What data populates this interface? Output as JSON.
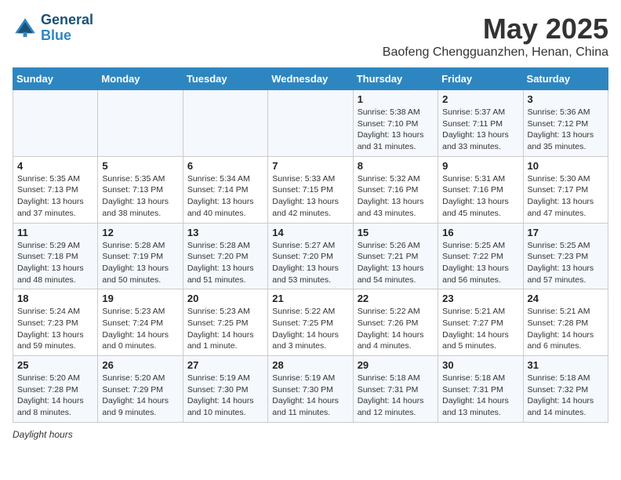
{
  "header": {
    "logo_line1": "General",
    "logo_line2": "Blue",
    "month": "May 2025",
    "location": "Baofeng Chengguanzhen, Henan, China"
  },
  "weekdays": [
    "Sunday",
    "Monday",
    "Tuesday",
    "Wednesday",
    "Thursday",
    "Friday",
    "Saturday"
  ],
  "weeks": [
    [
      {
        "day": "",
        "info": ""
      },
      {
        "day": "",
        "info": ""
      },
      {
        "day": "",
        "info": ""
      },
      {
        "day": "",
        "info": ""
      },
      {
        "day": "1",
        "info": "Sunrise: 5:38 AM\nSunset: 7:10 PM\nDaylight: 13 hours\nand 31 minutes."
      },
      {
        "day": "2",
        "info": "Sunrise: 5:37 AM\nSunset: 7:11 PM\nDaylight: 13 hours\nand 33 minutes."
      },
      {
        "day": "3",
        "info": "Sunrise: 5:36 AM\nSunset: 7:12 PM\nDaylight: 13 hours\nand 35 minutes."
      }
    ],
    [
      {
        "day": "4",
        "info": "Sunrise: 5:35 AM\nSunset: 7:13 PM\nDaylight: 13 hours\nand 37 minutes."
      },
      {
        "day": "5",
        "info": "Sunrise: 5:35 AM\nSunset: 7:13 PM\nDaylight: 13 hours\nand 38 minutes."
      },
      {
        "day": "6",
        "info": "Sunrise: 5:34 AM\nSunset: 7:14 PM\nDaylight: 13 hours\nand 40 minutes."
      },
      {
        "day": "7",
        "info": "Sunrise: 5:33 AM\nSunset: 7:15 PM\nDaylight: 13 hours\nand 42 minutes."
      },
      {
        "day": "8",
        "info": "Sunrise: 5:32 AM\nSunset: 7:16 PM\nDaylight: 13 hours\nand 43 minutes."
      },
      {
        "day": "9",
        "info": "Sunrise: 5:31 AM\nSunset: 7:16 PM\nDaylight: 13 hours\nand 45 minutes."
      },
      {
        "day": "10",
        "info": "Sunrise: 5:30 AM\nSunset: 7:17 PM\nDaylight: 13 hours\nand 47 minutes."
      }
    ],
    [
      {
        "day": "11",
        "info": "Sunrise: 5:29 AM\nSunset: 7:18 PM\nDaylight: 13 hours\nand 48 minutes."
      },
      {
        "day": "12",
        "info": "Sunrise: 5:28 AM\nSunset: 7:19 PM\nDaylight: 13 hours\nand 50 minutes."
      },
      {
        "day": "13",
        "info": "Sunrise: 5:28 AM\nSunset: 7:20 PM\nDaylight: 13 hours\nand 51 minutes."
      },
      {
        "day": "14",
        "info": "Sunrise: 5:27 AM\nSunset: 7:20 PM\nDaylight: 13 hours\nand 53 minutes."
      },
      {
        "day": "15",
        "info": "Sunrise: 5:26 AM\nSunset: 7:21 PM\nDaylight: 13 hours\nand 54 minutes."
      },
      {
        "day": "16",
        "info": "Sunrise: 5:25 AM\nSunset: 7:22 PM\nDaylight: 13 hours\nand 56 minutes."
      },
      {
        "day": "17",
        "info": "Sunrise: 5:25 AM\nSunset: 7:23 PM\nDaylight: 13 hours\nand 57 minutes."
      }
    ],
    [
      {
        "day": "18",
        "info": "Sunrise: 5:24 AM\nSunset: 7:23 PM\nDaylight: 13 hours\nand 59 minutes."
      },
      {
        "day": "19",
        "info": "Sunrise: 5:23 AM\nSunset: 7:24 PM\nDaylight: 14 hours\nand 0 minutes."
      },
      {
        "day": "20",
        "info": "Sunrise: 5:23 AM\nSunset: 7:25 PM\nDaylight: 14 hours\nand 1 minute."
      },
      {
        "day": "21",
        "info": "Sunrise: 5:22 AM\nSunset: 7:25 PM\nDaylight: 14 hours\nand 3 minutes."
      },
      {
        "day": "22",
        "info": "Sunrise: 5:22 AM\nSunset: 7:26 PM\nDaylight: 14 hours\nand 4 minutes."
      },
      {
        "day": "23",
        "info": "Sunrise: 5:21 AM\nSunset: 7:27 PM\nDaylight: 14 hours\nand 5 minutes."
      },
      {
        "day": "24",
        "info": "Sunrise: 5:21 AM\nSunset: 7:28 PM\nDaylight: 14 hours\nand 6 minutes."
      }
    ],
    [
      {
        "day": "25",
        "info": "Sunrise: 5:20 AM\nSunset: 7:28 PM\nDaylight: 14 hours\nand 8 minutes."
      },
      {
        "day": "26",
        "info": "Sunrise: 5:20 AM\nSunset: 7:29 PM\nDaylight: 14 hours\nand 9 minutes."
      },
      {
        "day": "27",
        "info": "Sunrise: 5:19 AM\nSunset: 7:30 PM\nDaylight: 14 hours\nand 10 minutes."
      },
      {
        "day": "28",
        "info": "Sunrise: 5:19 AM\nSunset: 7:30 PM\nDaylight: 14 hours\nand 11 minutes."
      },
      {
        "day": "29",
        "info": "Sunrise: 5:18 AM\nSunset: 7:31 PM\nDaylight: 14 hours\nand 12 minutes."
      },
      {
        "day": "30",
        "info": "Sunrise: 5:18 AM\nSunset: 7:31 PM\nDaylight: 14 hours\nand 13 minutes."
      },
      {
        "day": "31",
        "info": "Sunrise: 5:18 AM\nSunset: 7:32 PM\nDaylight: 14 hours\nand 14 minutes."
      }
    ]
  ],
  "legend": {
    "text": "Daylight hours"
  }
}
